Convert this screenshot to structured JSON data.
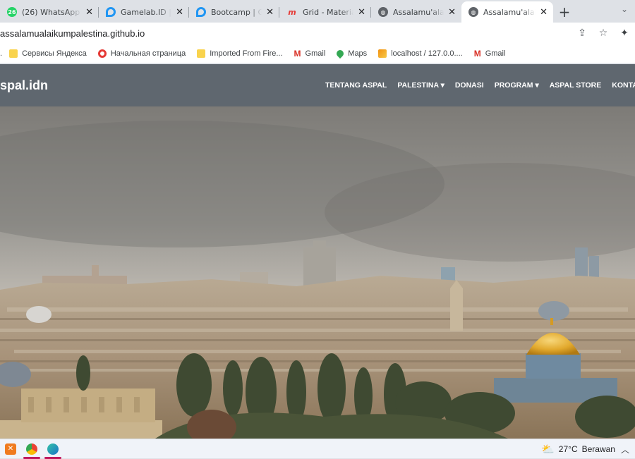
{
  "browser": {
    "tabs": [
      {
        "title": "(26) WhatsApp",
        "badge": "26",
        "icon": "whatsapp-icon",
        "color": "#25d366"
      },
      {
        "title": "Gamelab.ID | C",
        "icon": "gamelab-icon",
        "color": "#2196f3"
      },
      {
        "title": "Bootcamp | Ga",
        "icon": "bootcamp-icon",
        "color": "#2196f3"
      },
      {
        "title": "Grid - Material",
        "icon": "materialize-icon",
        "color": "#e53935"
      },
      {
        "title": "Assalamu'alaik",
        "icon": "globe-icon",
        "color": "#5f6368"
      },
      {
        "title": "Assalamu'alaik",
        "icon": "globe-icon",
        "color": "#5f6368",
        "active": true
      }
    ],
    "new_tab": "+",
    "url": "assalamualaikumpalestina.github.io",
    "bookmarks": [
      {
        "label": "Сервисы Яндекса",
        "icon": "folder-icon",
        "color": "#f9d34d"
      },
      {
        "label": "Начальная страница",
        "icon": "opera-icon",
        "color": "#e53935"
      },
      {
        "label": "Imported From Fire...",
        "icon": "folder-icon",
        "color": "#f9d34d"
      },
      {
        "label": "Gmail",
        "icon": "gmail-icon",
        "color": "#d93025"
      },
      {
        "label": "Maps",
        "icon": "maps-icon",
        "color": "#34a853"
      },
      {
        "label": "localhost / 127.0.0....",
        "icon": "phpmyadmin-icon",
        "color": "#f29111"
      },
      {
        "label": "Gmail",
        "icon": "gmail-icon",
        "color": "#d93025"
      }
    ]
  },
  "site": {
    "brand": "spal.idn",
    "nav": [
      {
        "label": "TENTANG ASPAL"
      },
      {
        "label": "PALESTINA ▾"
      },
      {
        "label": "DONASI"
      },
      {
        "label": "PROGRAM ▾"
      },
      {
        "label": "ASPAL STORE"
      },
      {
        "label": "KONTA"
      }
    ],
    "navbar_color": "#5f676f"
  },
  "taskbar": {
    "weather_temp": "27°C",
    "weather_text": "Berawan"
  }
}
